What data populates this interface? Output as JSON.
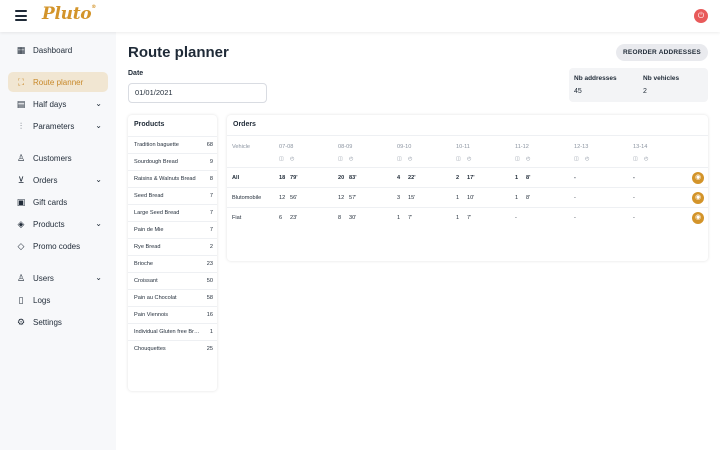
{
  "app": {
    "logo": "Pluto",
    "logo_mark": "®"
  },
  "sidebar": {
    "items": [
      {
        "label": "Dashboard",
        "icon": "layout-icon"
      },
      {
        "label": "Route planner",
        "icon": "map-icon",
        "active": true
      },
      {
        "label": "Half days",
        "icon": "calendar-icon",
        "expandable": true
      },
      {
        "label": "Parameters",
        "icon": "sliders-icon",
        "expandable": true
      },
      {
        "label": "Customers",
        "icon": "user-icon"
      },
      {
        "label": "Orders",
        "icon": "cart-icon",
        "expandable": true
      },
      {
        "label": "Gift cards",
        "icon": "gift-icon"
      },
      {
        "label": "Products",
        "icon": "box-icon",
        "expandable": true
      },
      {
        "label": "Promo codes",
        "icon": "tag-icon"
      },
      {
        "label": "Users",
        "icon": "users-icon",
        "expandable": true
      },
      {
        "label": "Logs",
        "icon": "clipboard-icon"
      },
      {
        "label": "Settings",
        "icon": "gear-icon"
      }
    ]
  },
  "main": {
    "title": "Route planner",
    "reorder_label": "REORDER ADDRESSES",
    "date_label": "Date",
    "date_value": "01/01/2021",
    "stats": {
      "nb_addresses_label": "Nb addresses",
      "nb_addresses_value": "45",
      "nb_vehicles_label": "Nb vehicles",
      "nb_vehicles_value": "2"
    },
    "products": {
      "title": "Products",
      "rows": [
        {
          "name": "Tradition baguette",
          "qty": "68"
        },
        {
          "name": "Sourdough Bread",
          "qty": "9"
        },
        {
          "name": "Raisins & Walnuts Bread",
          "qty": "8"
        },
        {
          "name": "Seed Bread",
          "qty": "7"
        },
        {
          "name": "Large Seed Bread",
          "qty": "7"
        },
        {
          "name": "Pain de Mie",
          "qty": "7"
        },
        {
          "name": "Rye Bread",
          "qty": "2"
        },
        {
          "name": "Brioche",
          "qty": "23"
        },
        {
          "name": "Croissant",
          "qty": "50"
        },
        {
          "name": "Pain au Chocolat",
          "qty": "58"
        },
        {
          "name": "Pain Viennois",
          "qty": "16"
        },
        {
          "name": "Individual Gluten free Bread",
          "qty": "1"
        },
        {
          "name": "Chouquettes",
          "qty": "25"
        }
      ]
    },
    "orders": {
      "title": "Orders",
      "vehicle_header": "Vehicle",
      "slots": [
        "07-08",
        "08-09",
        "09-10",
        "10-11",
        "11-12",
        "12-13",
        "13-14"
      ],
      "rows": [
        {
          "vehicle": "All",
          "bold": true,
          "cells": [
            [
              "18",
              "79'"
            ],
            [
              "20",
              "83'"
            ],
            [
              "4",
              "22'"
            ],
            [
              "2",
              "17'"
            ],
            [
              "1",
              "8'"
            ],
            [
              "-",
              ""
            ],
            [
              "-",
              ""
            ]
          ]
        },
        {
          "vehicle": "Blutomobile",
          "bold": false,
          "cells": [
            [
              "12",
              "56'"
            ],
            [
              "12",
              "57'"
            ],
            [
              "3",
              "15'"
            ],
            [
              "1",
              "10'"
            ],
            [
              "1",
              "8'"
            ],
            [
              "-",
              ""
            ],
            [
              "-",
              ""
            ]
          ]
        },
        {
          "vehicle": "Fiat",
          "bold": false,
          "cells": [
            [
              "6",
              "23'"
            ],
            [
              "8",
              "30'"
            ],
            [
              "1",
              "7'"
            ],
            [
              "1",
              "7'"
            ],
            [
              "-",
              ""
            ],
            [
              "-",
              ""
            ],
            [
              "-",
              ""
            ]
          ]
        }
      ]
    }
  }
}
